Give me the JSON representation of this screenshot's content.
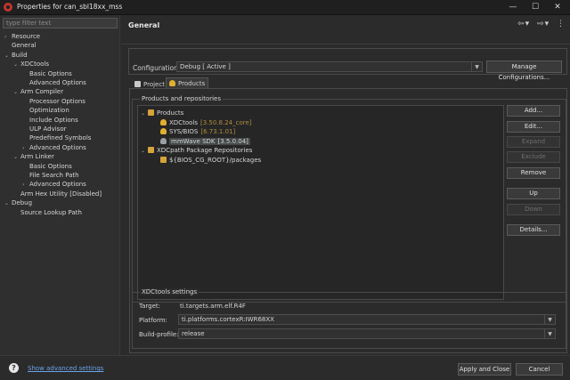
{
  "window": {
    "title": "Properties for can_sbl18xx_mss",
    "minimize": "—",
    "maximize": "☐",
    "close": "✕"
  },
  "filter_placeholder": "type filter text",
  "nav_tree": [
    {
      "label": "Resource",
      "depth": 0,
      "twisty": "›"
    },
    {
      "label": "General",
      "depth": 0,
      "twisty": ""
    },
    {
      "label": "Build",
      "depth": 0,
      "twisty": "⌄"
    },
    {
      "label": "XDCtools",
      "depth": 1,
      "twisty": "⌄"
    },
    {
      "label": "Basic Options",
      "depth": 2,
      "twisty": ""
    },
    {
      "label": "Advanced Options",
      "depth": 2,
      "twisty": ""
    },
    {
      "label": "Arm Compiler",
      "depth": 1,
      "twisty": "⌄"
    },
    {
      "label": "Processor Options",
      "depth": 2,
      "twisty": ""
    },
    {
      "label": "Optimization",
      "depth": 2,
      "twisty": ""
    },
    {
      "label": "Include Options",
      "depth": 2,
      "twisty": ""
    },
    {
      "label": "ULP Advisor",
      "depth": 2,
      "twisty": ""
    },
    {
      "label": "Predefined Symbols",
      "depth": 2,
      "twisty": ""
    },
    {
      "label": "Advanced Options",
      "depth": 2,
      "twisty": "›"
    },
    {
      "label": "Arm Linker",
      "depth": 1,
      "twisty": "⌄"
    },
    {
      "label": "Basic Options",
      "depth": 2,
      "twisty": ""
    },
    {
      "label": "File Search Path",
      "depth": 2,
      "twisty": ""
    },
    {
      "label": "Advanced Options",
      "depth": 2,
      "twisty": "›"
    },
    {
      "label": "Arm Hex Utility  [Disabled]",
      "depth": 1,
      "twisty": ""
    },
    {
      "label": "Debug",
      "depth": 0,
      "twisty": "⌄"
    },
    {
      "label": "Source Lookup Path",
      "depth": 1,
      "twisty": ""
    }
  ],
  "page_title": "General",
  "nav_icons": {
    "back": "⇦",
    "forward": "⇨",
    "menu": "⋮",
    "dropdown": "▾"
  },
  "configuration": {
    "label": "Configuration:",
    "value": "Debug  [ Active ]",
    "manage_button": "Manage Configurations..."
  },
  "tabs": [
    {
      "label": "Project",
      "active": false
    },
    {
      "label": "Products",
      "active": true
    }
  ],
  "products_group": {
    "title": "Products and repositories",
    "tree": [
      {
        "label": "Products",
        "version": "",
        "depth": 0,
        "icon": "folder",
        "twisty": "⌄"
      },
      {
        "label": "XDCtools",
        "version": "[3.50.8.24_core]",
        "depth": 1,
        "icon": "prod"
      },
      {
        "label": "SYS/BIOS",
        "version": "[6.73.1.01]",
        "depth": 1,
        "icon": "prod"
      },
      {
        "label": "mmWave SDK",
        "version": "[3.5.0.04]",
        "depth": 1,
        "icon": "prodgrey",
        "selected": true
      },
      {
        "label": "XDCpath Package Repositories",
        "version": "",
        "depth": 0,
        "icon": "folder",
        "twisty": "⌄"
      },
      {
        "label": "${BIOS_CG_ROOT}/packages",
        "version": "",
        "depth": 1,
        "icon": "folder"
      }
    ],
    "buttons": [
      {
        "label": "Add...",
        "enabled": true,
        "mnemonic": "A"
      },
      {
        "label": "Edit...",
        "enabled": true,
        "mnemonic": "E"
      },
      {
        "label": "Expand",
        "enabled": false,
        "mnemonic": "x"
      },
      {
        "label": "Exclude",
        "enabled": false,
        "mnemonic": "c"
      },
      {
        "label": "Remove",
        "enabled": true,
        "mnemonic": "R"
      },
      {
        "label": "Up",
        "enabled": true,
        "mnemonic": "U"
      },
      {
        "label": "Down",
        "enabled": false,
        "mnemonic": "D"
      },
      {
        "label": "Details...",
        "enabled": true,
        "mnemonic": "t"
      }
    ]
  },
  "xdc_settings": {
    "title": "XDCtools settings",
    "target_label": "Target:",
    "target_value": "ti.targets.arm.elf.R4F",
    "platform_label": "Platform:",
    "platform_value": "ti.platforms.cortexR:IWR68XX",
    "profile_label": "Build-profile:",
    "profile_value": "release"
  },
  "footer": {
    "help_icon": "?",
    "advanced_link": "Show advanced settings",
    "apply_close": "Apply and Close",
    "cancel": "Cancel"
  },
  "colors": {
    "accent_link": "#6aa3e8",
    "version_text": "#b08b3c",
    "background": "#2b2b2b"
  }
}
